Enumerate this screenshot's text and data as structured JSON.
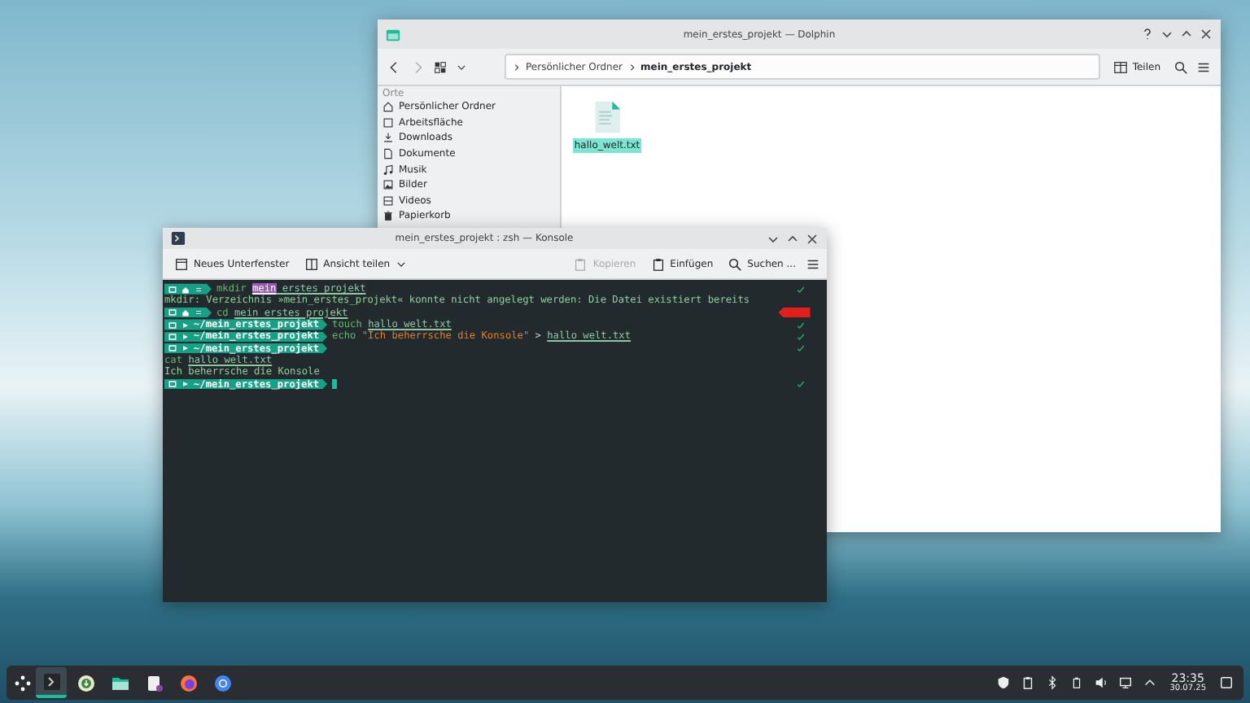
{
  "dolphin": {
    "title": "mein_erstes_projekt — Dolphin",
    "breadcrumb": [
      {
        "label": "Persönlicher Ordner",
        "current": false
      },
      {
        "label": "mein_erstes_projekt",
        "current": true
      }
    ],
    "share_label": "Teilen",
    "places_heading": "Orte",
    "places": [
      {
        "label": "Persönlicher Ordner"
      },
      {
        "label": "Arbeitsfläche"
      },
      {
        "label": "Downloads"
      },
      {
        "label": "Dokumente"
      },
      {
        "label": "Musik"
      },
      {
        "label": "Bilder"
      },
      {
        "label": "Videos"
      },
      {
        "label": "Papierkorb"
      }
    ],
    "files": [
      {
        "name": "hallo_welt.txt",
        "selected": true
      }
    ]
  },
  "konsole": {
    "title": "mein_erstes_projekt : zsh — Konsole",
    "toolbar_left": [
      {
        "label": "Neues Unterfenster",
        "disabled": false,
        "dropdown": false
      },
      {
        "label": "Ansicht teilen",
        "disabled": false,
        "dropdown": true
      }
    ],
    "toolbar_right": [
      {
        "label": "Kopieren",
        "disabled": true
      },
      {
        "label": "Einfügen",
        "disabled": false
      },
      {
        "label": "Suchen ...",
        "disabled": false
      }
    ],
    "lines": [
      {
        "kind": "prompt",
        "failed": false,
        "parts": [
          {
            "text": "mkdir ",
            "kind": "command"
          },
          {
            "text": "mein",
            "kind": "highlight"
          },
          {
            "text": "_erstes_projekt",
            "kind": "argument"
          }
        ]
      },
      {
        "kind": "output",
        "parts": [
          {
            "text": "mkdir: Verzeichnis »mein_erstes_projekt« konnte nicht angelegt werden: Die Datei existiert bereits",
            "kind": "output"
          }
        ]
      },
      {
        "kind": "prompt",
        "failed": true,
        "parts": [
          {
            "text": "cd ",
            "kind": "command"
          },
          {
            "text": "mein_erstes_projekt",
            "kind": "argument"
          }
        ]
      },
      {
        "kind": "prompt",
        "path": "~/mein_erstes_projekt",
        "failed": false,
        "parts": [
          {
            "text": "touch ",
            "kind": "command"
          },
          {
            "text": "hallo_welt.txt",
            "kind": "argument"
          }
        ]
      },
      {
        "kind": "prompt",
        "path": "~/mein_erstes_projekt",
        "failed": false,
        "parts": [
          {
            "text": "echo ",
            "kind": "command"
          },
          {
            "text": "\"Ich beherrsche die Konsole\"",
            "kind": "string"
          },
          {
            "text": " > ",
            "kind": "plain"
          },
          {
            "text": "hallo_welt.txt",
            "kind": "argument"
          }
        ]
      },
      {
        "kind": "prompt",
        "path": "~/mein_erstes_projekt",
        "failed": false
      },
      {
        "kind": "output",
        "parts": [
          {
            "text": "cat ",
            "kind": "command"
          },
          {
            "text": "hallo_welt.txt",
            "kind": "argument"
          }
        ]
      },
      {
        "kind": "output",
        "parts": [
          {
            "text": "Ich beherrsche die Konsole",
            "kind": "output"
          }
        ]
      },
      {
        "kind": "prompt",
        "path": "~/mein_erstes_projekt",
        "failed": false,
        "cursor": true
      }
    ]
  },
  "taskbar": {
    "apps": [
      {
        "selected": true
      },
      {
        "selected": false
      },
      {
        "selected": false
      },
      {
        "selected": false
      },
      {
        "selected": false
      },
      {
        "selected": false
      }
    ],
    "time": "23:35",
    "date": "30.07.25"
  }
}
